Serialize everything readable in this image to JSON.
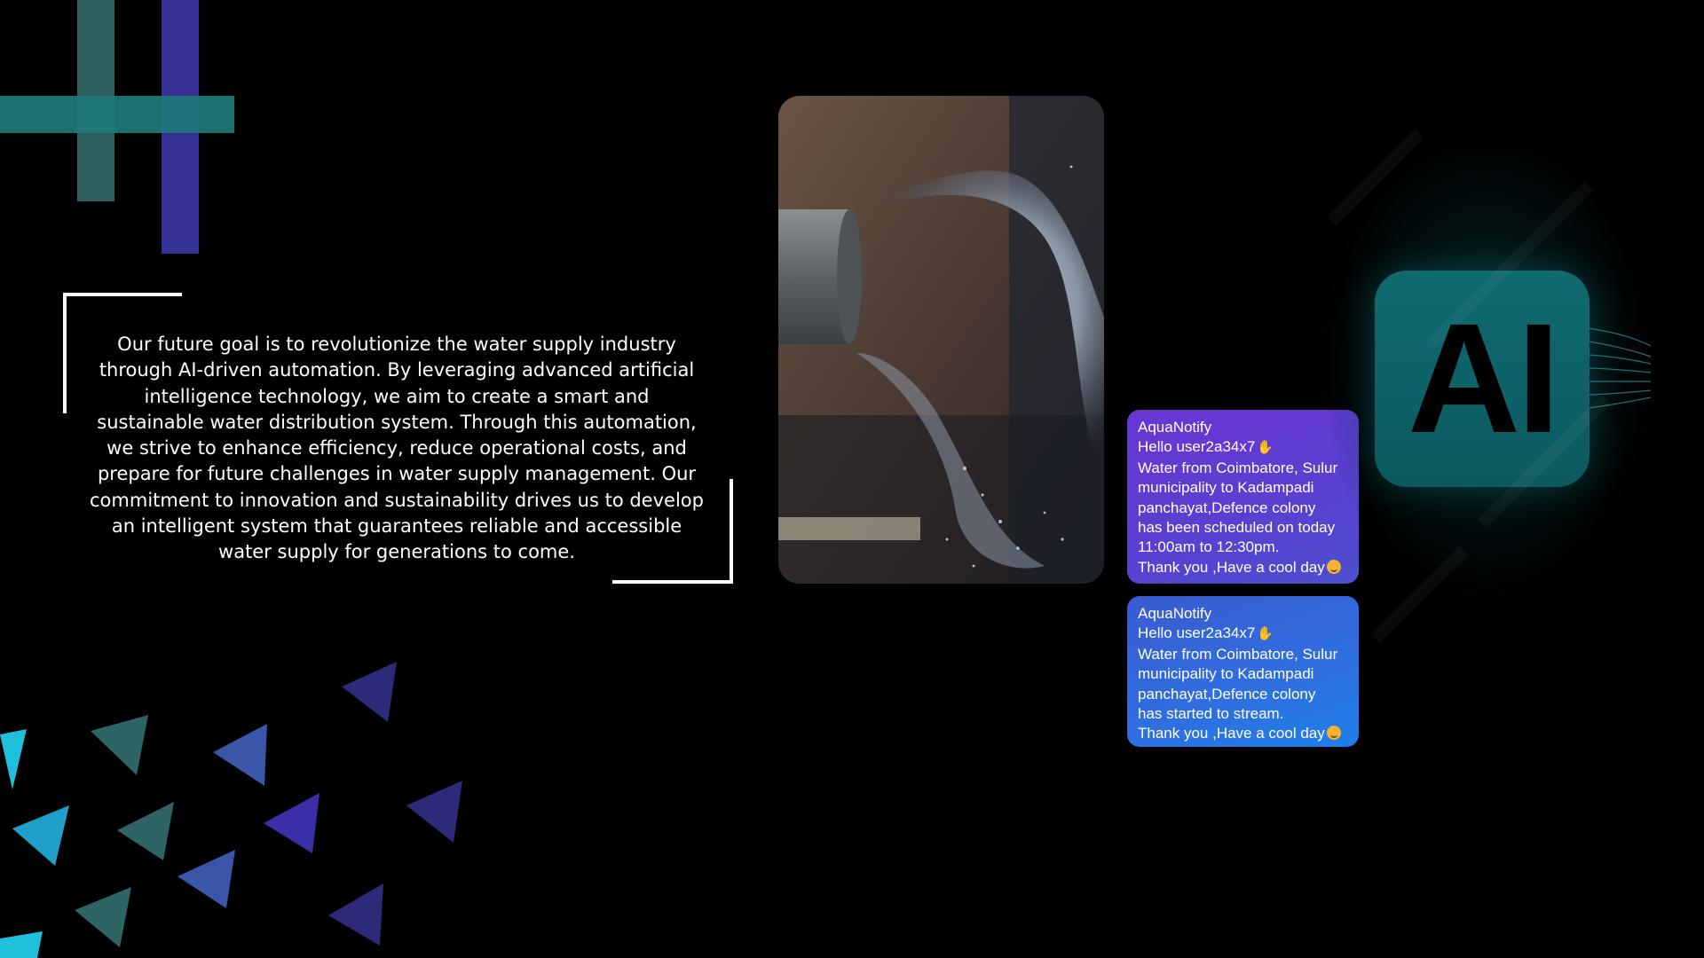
{
  "goal": {
    "text": "Our future goal is to revolutionize the water supply industry through AI-driven automation. By leveraging advanced artificial intelligence technology, we aim to create a smart and sustainable water distribution system. Through this automation, we strive to enhance efficiency, reduce operational costs, and prepare for future challenges in water supply management. Our commitment to innovation and sustainability drives us to develop an intelligent system that guarantees reliable and accessible water supply for generations to come."
  },
  "notifications": [
    {
      "sender": "AquaNotify",
      "greeting": "Hello user2a34x7",
      "lines": [
        "Water from Coimbatore, Sulur",
        "municipality to Kadampadi",
        "panchayat,Defence colony",
        "has been scheduled on today",
        "11:00am to 12:30pm."
      ],
      "closing": "Thank you ,Have a cool day"
    },
    {
      "sender": "AquaNotify",
      "greeting": "Hello user2a34x7",
      "lines": [
        "Water from Coimbatore, Sulur",
        "municipality to Kadampadi",
        "panchayat,Defence colony",
        "has started to stream."
      ],
      "closing": "Thank you ,Have a cool day"
    }
  ],
  "ai_badge": {
    "label": "AI"
  },
  "colors": {
    "background": "#000000",
    "teal": "#1e7a7a",
    "indigo": "#3a34a0",
    "notif_purple": "#6a35d2",
    "notif_blue": "#2f6fe0"
  },
  "icons": [
    "waving-hand-icon",
    "smiling-face-icon",
    "ai-chip-icon"
  ]
}
